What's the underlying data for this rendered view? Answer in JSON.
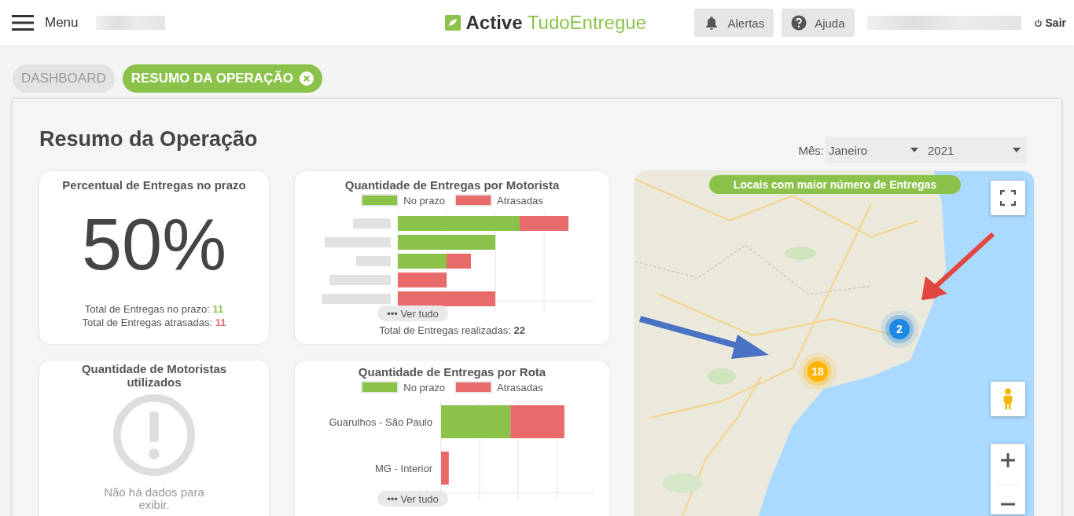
{
  "header": {
    "menu_label": "Menu",
    "logo": {
      "bold": "Active",
      "light": "TudoEntregue"
    },
    "buttons": [
      {
        "kind": "alert",
        "label": "Alertas"
      },
      {
        "kind": "help",
        "label": "Ajuda"
      }
    ],
    "logout": "Sair"
  },
  "tabs": [
    {
      "label": "DASHBOARD",
      "selected": false,
      "closable": false
    },
    {
      "label": "RESUMO DA OPERAÇÃO",
      "selected": true,
      "closable": true
    }
  ],
  "page": {
    "title": "Resumo da Operação",
    "filter": {
      "label": "Mês:",
      "month": "Janeiro",
      "year": "2021"
    }
  },
  "percent_card": {
    "title": "Percentual de Entregas no prazo",
    "value": "50%",
    "lines": [
      {
        "label": "Total de Entregas no prazo:",
        "value": "11",
        "color": "#8bc34a"
      },
      {
        "label": "Total de Entregas atrasadas:",
        "value": "11",
        "color": "#e96a6a"
      }
    ]
  },
  "driver_chart": {
    "title": "Quantidade de Entregas por Motorista",
    "legend": [
      {
        "label": "No prazo",
        "color": "#8bc34a"
      },
      {
        "label": "Atrasadas",
        "color": "#e96a6a"
      }
    ],
    "more": "••• Ver tudo",
    "total_label": "Total de Entregas realizadas:",
    "total": "22"
  },
  "route_chart": {
    "title": "Quantidade de Entregas por Rota",
    "legend": [
      {
        "label": "No prazo",
        "color": "#8bc34a"
      },
      {
        "label": "Atrasadas",
        "color": "#e96a6a"
      }
    ],
    "categories": [
      "Guarulhos - São Paulo",
      "MG - Interior"
    ],
    "more": "••• Ver tudo"
  },
  "drivers_card": {
    "title": "Quantidade de Motoristas utilizados",
    "empty": "Não há dados para exibir."
  },
  "map": {
    "title": "Locais com maior número de Entregas",
    "clusters": [
      {
        "count": "2",
        "color": "#1e88e5"
      },
      {
        "count": "18",
        "color": "#ffb300"
      }
    ]
  }
}
